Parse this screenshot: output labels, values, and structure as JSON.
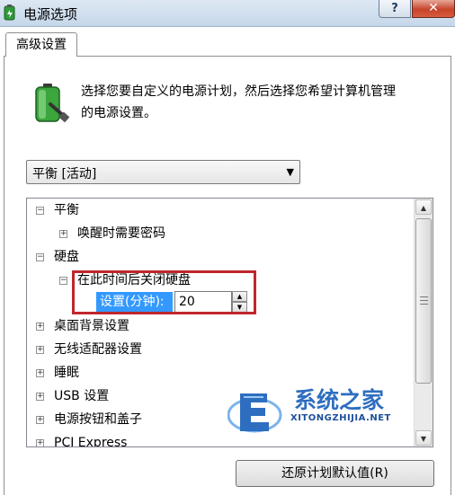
{
  "window": {
    "title": "电源选项",
    "help_label": "?",
    "close_label": "✕"
  },
  "tabs": [
    {
      "label": "高级设置"
    }
  ],
  "intro": {
    "line1": "选择您要自定义的电源计划，然后选择您希望计算机管理",
    "line2": "的电源设置。",
    "icon": "battery-plug-icon"
  },
  "plan_select": {
    "value": "平衡 [活动]"
  },
  "tree": {
    "items": [
      {
        "label": "平衡",
        "expander": "⊟"
      },
      {
        "label": "唤醒时需要密码",
        "expander": "⊞"
      },
      {
        "label": "硬盘",
        "expander": "⊟"
      },
      {
        "label": "在此时间后关闭硬盘",
        "expander": "⊟"
      },
      {
        "label": "桌面背景设置",
        "expander": "⊞"
      },
      {
        "label": "无线适配器设置",
        "expander": "⊞"
      },
      {
        "label": "睡眠",
        "expander": "⊞"
      },
      {
        "label": "USB 设置",
        "expander": "⊞"
      },
      {
        "label": "电源按钮和盖子",
        "expander": "⊞"
      },
      {
        "label": "PCI Express",
        "expander": "⊞"
      }
    ],
    "setting": {
      "label": "设置(分钟):",
      "value": "20"
    }
  },
  "watermark": {
    "title": "系统之家",
    "domain": "XITONGZHIJIA.NET"
  },
  "buttons": {
    "restore": "还原计划默认值(R)"
  },
  "colors": {
    "selection": "#3399ff",
    "highlight_border": "#c0262d",
    "watermark_blue": "#2e6ec0"
  }
}
